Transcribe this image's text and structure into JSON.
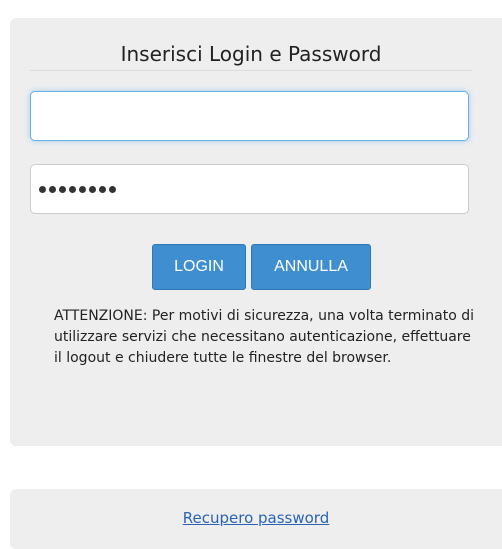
{
  "login_form": {
    "title": "Inserisci Login e Password",
    "username_value": "",
    "password_masked": "••••••••",
    "login_button": "LOGIN",
    "cancel_button": "ANNULLA",
    "warning_text": "ATTENZIONE: Per motivi di sicurezza, una volta terminato di utilizzare servizi che necessitano autenticazione, effettuare il logout e chiudere tutte le finestre del browser."
  },
  "footer": {
    "recover_link": "Recupero password"
  },
  "colors": {
    "panel_bg": "#eeeeee",
    "button_bg": "#3f8ed0",
    "link": "#2b63b4",
    "focus_border": "#66afe9"
  }
}
